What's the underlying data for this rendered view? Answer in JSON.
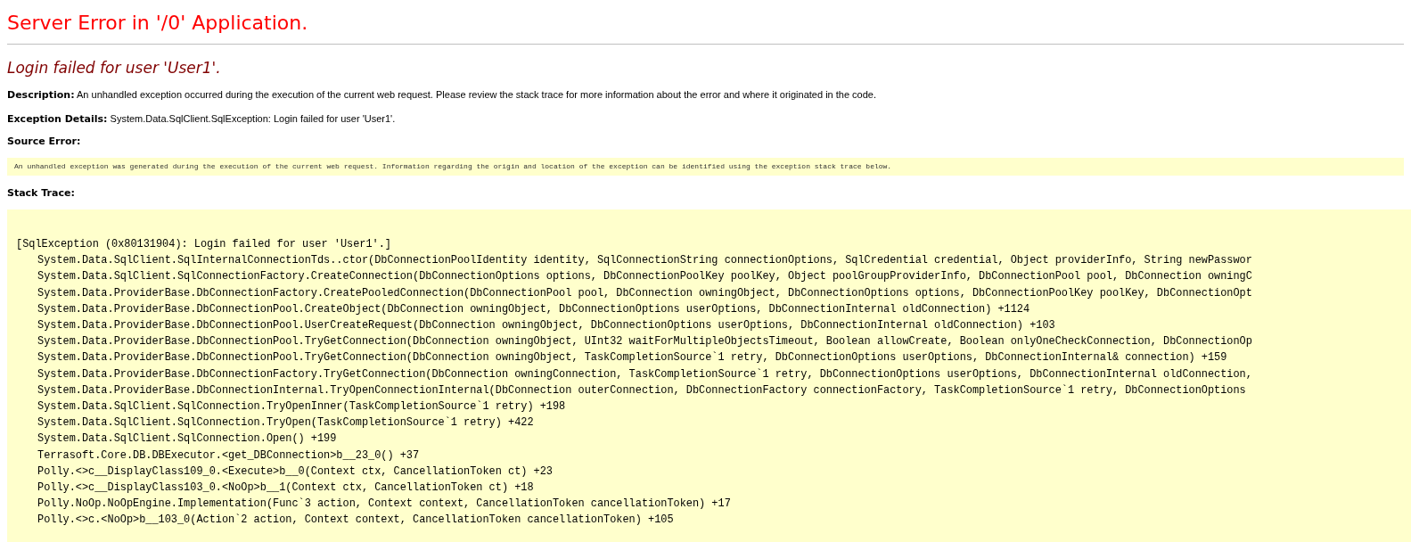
{
  "title": "Server Error in '/0' Application.",
  "subtitle": "Login failed for user 'User1'.",
  "description": {
    "label": "Description:",
    "text": "An unhandled exception occurred during the execution of the current web request. Please review the stack trace for more information about the error and where it originated in the code."
  },
  "exception_details": {
    "label": "Exception Details:",
    "text": "System.Data.SqlClient.SqlException: Login failed for user 'User1'."
  },
  "source_error": {
    "label": "Source Error:",
    "text": "An unhandled exception was generated during the execution of the current web request. Information regarding the origin and location of the exception can be identified using the exception stack trace below."
  },
  "stack_trace": {
    "label": "Stack Trace:",
    "exception": "[SqlException (0x80131904): Login failed for user 'User1'.]",
    "frames": [
      "System.Data.SqlClient.SqlInternalConnectionTds..ctor(DbConnectionPoolIdentity identity, SqlConnectionString connectionOptions, SqlCredential credential, Object providerInfo, String newPasswor",
      "System.Data.SqlClient.SqlConnectionFactory.CreateConnection(DbConnectionOptions options, DbConnectionPoolKey poolKey, Object poolGroupProviderInfo, DbConnectionPool pool, DbConnection owningC",
      "System.Data.ProviderBase.DbConnectionFactory.CreatePooledConnection(DbConnectionPool pool, DbConnection owningObject, DbConnectionOptions options, DbConnectionPoolKey poolKey, DbConnectionOpt",
      "System.Data.ProviderBase.DbConnectionPool.CreateObject(DbConnection owningObject, DbConnectionOptions userOptions, DbConnectionInternal oldConnection) +1124",
      "System.Data.ProviderBase.DbConnectionPool.UserCreateRequest(DbConnection owningObject, DbConnectionOptions userOptions, DbConnectionInternal oldConnection) +103",
      "System.Data.ProviderBase.DbConnectionPool.TryGetConnection(DbConnection owningObject, UInt32 waitForMultipleObjectsTimeout, Boolean allowCreate, Boolean onlyOneCheckConnection, DbConnectionOp",
      "System.Data.ProviderBase.DbConnectionPool.TryGetConnection(DbConnection owningObject, TaskCompletionSource`1 retry, DbConnectionOptions userOptions, DbConnectionInternal& connection) +159",
      "System.Data.ProviderBase.DbConnectionFactory.TryGetConnection(DbConnection owningConnection, TaskCompletionSource`1 retry, DbConnectionOptions userOptions, DbConnectionInternal oldConnection,",
      "System.Data.ProviderBase.DbConnectionInternal.TryOpenConnectionInternal(DbConnection outerConnection, DbConnectionFactory connectionFactory, TaskCompletionSource`1 retry, DbConnectionOptions",
      "System.Data.SqlClient.SqlConnection.TryOpenInner(TaskCompletionSource`1 retry) +198",
      "System.Data.SqlClient.SqlConnection.TryOpen(TaskCompletionSource`1 retry) +422",
      "System.Data.SqlClient.SqlConnection.Open() +199",
      "Terrasoft.Core.DB.DBExecutor.<get_DBConnection>b__23_0() +37",
      "Polly.<>c__DisplayClass109_0.<Execute>b__0(Context ctx, CancellationToken ct) +23",
      "Polly.<>c__DisplayClass103_0.<NoOp>b__1(Context ctx, CancellationToken ct) +18",
      "Polly.NoOp.NoOpEngine.Implementation(Func`3 action, Context context, CancellationToken cancellationToken) +17",
      "Polly.<>c.<NoOp>b__103_0(Action`2 action, Context context, CancellationToken cancellationToken) +105"
    ]
  }
}
